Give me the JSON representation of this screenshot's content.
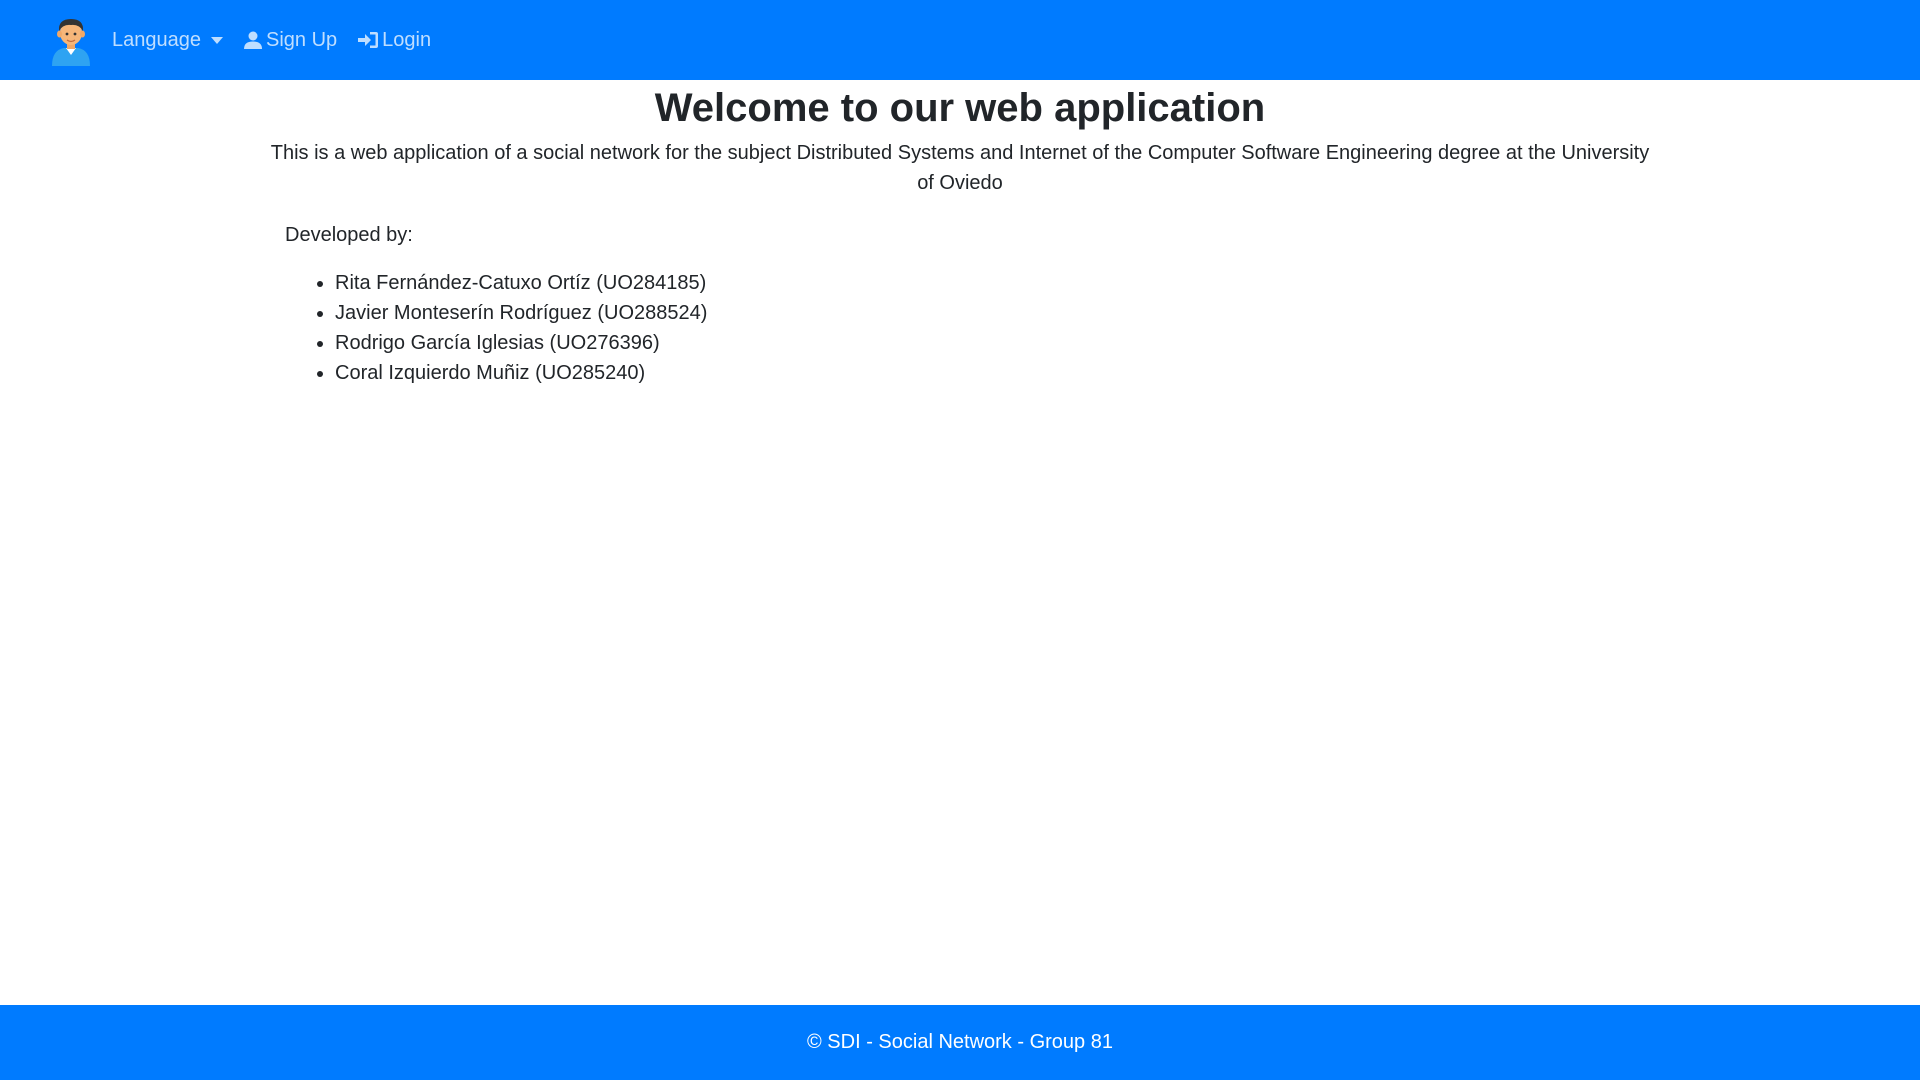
{
  "navbar": {
    "brand_icon": "user-avatar-icon",
    "language_label": "Language",
    "signup_label": "Sign Up",
    "signup_icon": "user-icon",
    "login_label": "Login",
    "login_icon": "sign-in-icon",
    "background_color": "#007bff"
  },
  "main": {
    "title": "Welcome to our web application",
    "intro": "This is a web application of a social network for the subject Distributed Systems and Internet of the Computer Software Engineering degree at the University of Oviedo",
    "developed_by_label": "Developed by:",
    "developers": [
      "Rita Fernández-Catuxo Ortíz (UO284185)",
      "Javier Monteserín Rodríguez (UO288524)",
      "Rodrigo García Iglesias (UO276396)",
      "Coral Izquierdo Muñiz (UO285240)"
    ]
  },
  "footer": {
    "text": "© SDI - Social Network - Group 81",
    "background_color": "#007bff"
  }
}
